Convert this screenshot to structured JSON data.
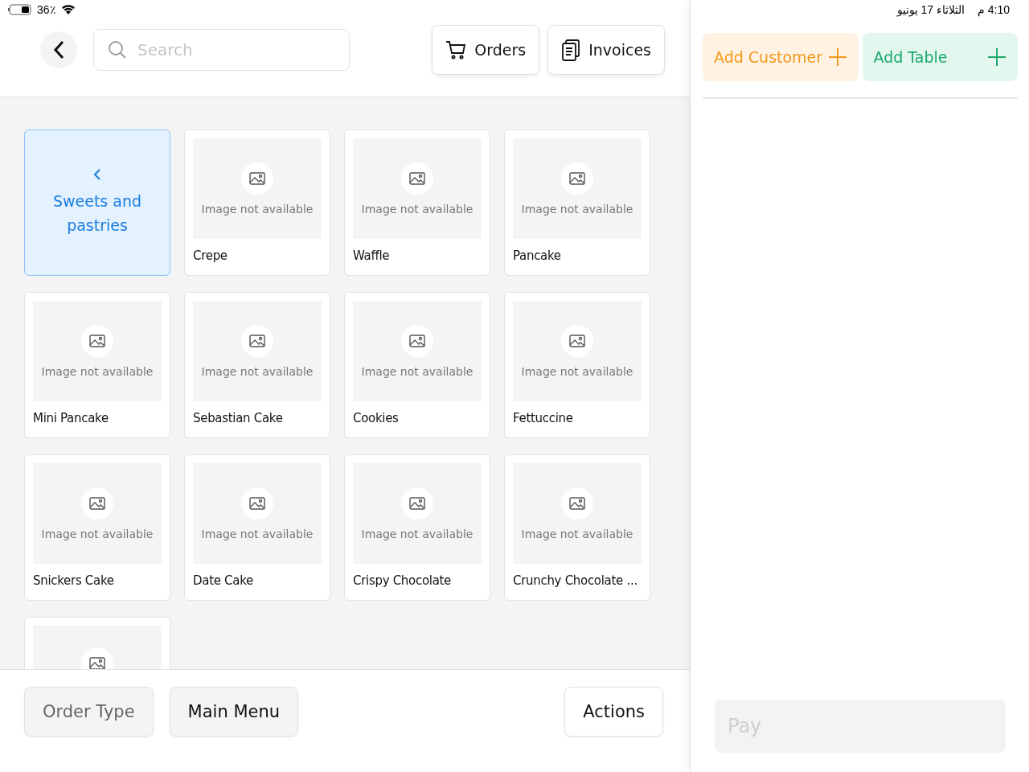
{
  "status_bar": {
    "battery": "36٪",
    "time": "4:10 م",
    "date": "الثلاثاء 17 يونيو"
  },
  "search": {
    "placeholder": "Search"
  },
  "header_buttons": [
    {
      "label": "Orders",
      "kind": "cart"
    },
    {
      "label": "Invoices",
      "kind": "clipboard"
    }
  ],
  "category_card": {
    "label": "Sweets and pastries",
    "selected": true
  },
  "items": [
    {
      "kind": "product",
      "name": "Crepe",
      "image_text": "Image not available"
    },
    {
      "kind": "product",
      "name": "Waffle",
      "image_text": "Image not available"
    },
    {
      "kind": "product",
      "name": "Pancake",
      "image_text": "Image not available"
    },
    {
      "kind": "product",
      "name": "Mini Pancake",
      "image_text": "Image not available"
    },
    {
      "kind": "product",
      "name": "Sebastian Cake",
      "image_text": "Image not available"
    },
    {
      "kind": "product",
      "name": "Cookies",
      "image_text": "Image not available"
    },
    {
      "kind": "product",
      "name": "Fettuccine",
      "image_text": "Image not available"
    },
    {
      "kind": "product",
      "name": "Snickers Cake",
      "image_text": "Image not available"
    },
    {
      "kind": "product",
      "name": "Date Cake",
      "image_text": "Image not available"
    },
    {
      "kind": "product",
      "name": "Crispy Chocolate",
      "image_text": "Image not available"
    },
    {
      "kind": "product",
      "name": "Crunchy Chocolate ...",
      "image_text": "Image not available"
    },
    {
      "kind": "cut"
    }
  ],
  "footer_buttons": [
    {
      "label": "Order Type",
      "disabled": true
    },
    {
      "label": "Main Menu",
      "disabled": false
    },
    {
      "label": "Actions",
      "disabled": false
    }
  ],
  "order_panel": {
    "add_buttons": [
      {
        "label": "Add Customer",
        "kind": "customer"
      },
      {
        "label": "Add Table",
        "kind": "table"
      }
    ],
    "pay_button": {
      "label": "Pay",
      "disabled": true
    }
  }
}
